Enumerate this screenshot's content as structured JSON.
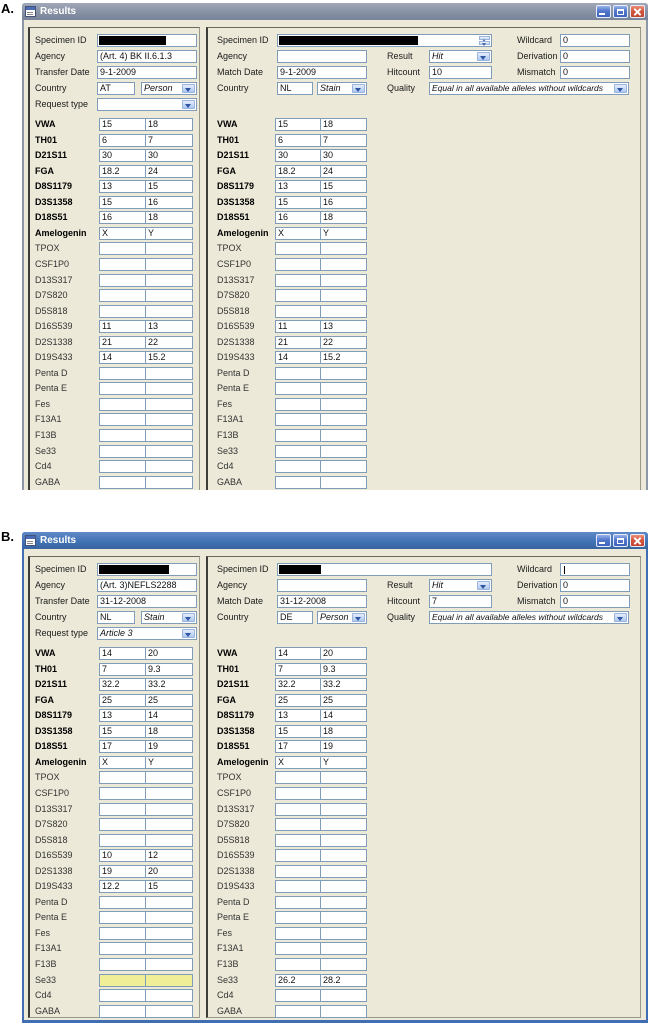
{
  "figure_labels": [
    "A.",
    "B."
  ],
  "colors": {
    "window_background": "#ece9d8",
    "titlebar_inactive": "#8d97a8",
    "titlebar_active": "#3f6fb2",
    "close_button_red": "#d55740",
    "field_border_blue": "#7f9db9",
    "highlight_yellow": "#f0ee96"
  },
  "windows": [
    {
      "title": "Results",
      "active": false,
      "left_panel": {
        "specimen_id_label": "Specimen ID",
        "specimen_id_redacted": true,
        "agency_label": "Agency",
        "agency": "(Art. 4) BK II.6.1.3",
        "date_label": "Transfer Date",
        "date": "9-1-2009",
        "country_label": "Country",
        "country_code": "AT",
        "sample_type": "Person",
        "request_type_label": "Request type",
        "request_type": ""
      },
      "right_panel": {
        "specimen_id_label": "Specimen ID",
        "specimen_id_redacted": true,
        "agency_label": "Agency",
        "agency": "",
        "date_label": "Match Date",
        "date": "9-1-2009",
        "country_label": "Country",
        "country_code": "NL",
        "sample_type": "Stain",
        "result_label": "Result",
        "result": "Hit",
        "hitcount_label": "Hitcount",
        "hitcount": "10",
        "quality_label": "Quality",
        "quality": "Equal in all available alleles without wildcards",
        "wildcard_label": "Wildcard",
        "wildcard": "0",
        "wildcard_cursor": false,
        "derivation_label": "Derivation",
        "derivation": "0",
        "mismatch_label": "Mismatch",
        "mismatch": "0"
      },
      "markers": [
        {
          "name": "VWA",
          "bold": true,
          "left": [
            "15",
            "18"
          ],
          "right": [
            "15",
            "18"
          ]
        },
        {
          "name": "TH01",
          "bold": true,
          "left": [
            "6",
            "7"
          ],
          "right": [
            "6",
            "7"
          ]
        },
        {
          "name": "D21S11",
          "bold": true,
          "left": [
            "30",
            "30"
          ],
          "right": [
            "30",
            "30"
          ]
        },
        {
          "name": "FGA",
          "bold": true,
          "left": [
            "18.2",
            "24"
          ],
          "right": [
            "18.2",
            "24"
          ]
        },
        {
          "name": "D8S1179",
          "bold": true,
          "left": [
            "13",
            "15"
          ],
          "right": [
            "13",
            "15"
          ]
        },
        {
          "name": "D3S1358",
          "bold": true,
          "left": [
            "15",
            "16"
          ],
          "right": [
            "15",
            "16"
          ]
        },
        {
          "name": "D18S51",
          "bold": true,
          "left": [
            "16",
            "18"
          ],
          "right": [
            "16",
            "18"
          ]
        },
        {
          "name": "Amelogenin",
          "bold": true,
          "left": [
            "X",
            "Y"
          ],
          "right": [
            "X",
            "Y"
          ]
        },
        {
          "name": "TPOX",
          "bold": false,
          "left": [
            "",
            ""
          ],
          "right": [
            "",
            ""
          ]
        },
        {
          "name": "CSF1P0",
          "bold": false,
          "left": [
            "",
            ""
          ],
          "right": [
            "",
            ""
          ]
        },
        {
          "name": "D13S317",
          "bold": false,
          "left": [
            "",
            ""
          ],
          "right": [
            "",
            ""
          ]
        },
        {
          "name": "D7S820",
          "bold": false,
          "left": [
            "",
            ""
          ],
          "right": [
            "",
            ""
          ]
        },
        {
          "name": "D5S818",
          "bold": false,
          "left": [
            "",
            ""
          ],
          "right": [
            "",
            ""
          ]
        },
        {
          "name": "D16S539",
          "bold": false,
          "left": [
            "11",
            "13"
          ],
          "right": [
            "11",
            "13"
          ]
        },
        {
          "name": "D2S1338",
          "bold": false,
          "left": [
            "21",
            "22"
          ],
          "right": [
            "21",
            "22"
          ]
        },
        {
          "name": "D19S433",
          "bold": false,
          "left": [
            "14",
            "15.2"
          ],
          "right": [
            "14",
            "15.2"
          ]
        },
        {
          "name": "Penta D",
          "bold": false,
          "left": [
            "",
            ""
          ],
          "right": [
            "",
            ""
          ]
        },
        {
          "name": "Penta E",
          "bold": false,
          "left": [
            "",
            ""
          ],
          "right": [
            "",
            ""
          ]
        },
        {
          "name": "Fes",
          "bold": false,
          "left": [
            "",
            ""
          ],
          "right": [
            "",
            ""
          ]
        },
        {
          "name": "F13A1",
          "bold": false,
          "left": [
            "",
            ""
          ],
          "right": [
            "",
            ""
          ]
        },
        {
          "name": "F13B",
          "bold": false,
          "left": [
            "",
            ""
          ],
          "right": [
            "",
            ""
          ]
        },
        {
          "name": "Se33",
          "bold": false,
          "left": [
            "",
            ""
          ],
          "right": [
            "",
            ""
          ]
        },
        {
          "name": "Cd4",
          "bold": false,
          "left": [
            "",
            ""
          ],
          "right": [
            "",
            ""
          ]
        },
        {
          "name": "GABA",
          "bold": false,
          "left": [
            "",
            ""
          ],
          "right": [
            "",
            ""
          ]
        }
      ]
    },
    {
      "title": "Results",
      "active": true,
      "left_panel": {
        "specimen_id_label": "Specimen ID",
        "specimen_id_redacted": true,
        "agency_label": "Agency",
        "agency": "(Art. 3)NEFLS2288",
        "date_label": "Transfer Date",
        "date": "31-12-2008",
        "country_label": "Country",
        "country_code": "NL",
        "sample_type": "Stain",
        "request_type_label": "Request type",
        "request_type": "Article 3"
      },
      "right_panel": {
        "specimen_id_label": "Specimen ID",
        "specimen_id_redacted": true,
        "agency_label": "Agency",
        "agency": "",
        "date_label": "Match Date",
        "date": "31-12-2008",
        "country_label": "Country",
        "country_code": "DE",
        "sample_type": "Person",
        "result_label": "Result",
        "result": "Hit",
        "hitcount_label": "Hitcount",
        "hitcount": "7",
        "quality_label": "Quality",
        "quality": "Equal in all available alleles without wildcards",
        "wildcard_label": "Wildcard",
        "wildcard": "",
        "wildcard_cursor": true,
        "derivation_label": "Derivation",
        "derivation": "0",
        "mismatch_label": "Mismatch",
        "mismatch": "0"
      },
      "markers": [
        {
          "name": "VWA",
          "bold": true,
          "left": [
            "14",
            "20"
          ],
          "right": [
            "14",
            "20"
          ]
        },
        {
          "name": "TH01",
          "bold": true,
          "left": [
            "7",
            "9.3"
          ],
          "right": [
            "7",
            "9.3"
          ]
        },
        {
          "name": "D21S11",
          "bold": true,
          "left": [
            "32.2",
            "33.2"
          ],
          "right": [
            "32.2",
            "33.2"
          ]
        },
        {
          "name": "FGA",
          "bold": true,
          "left": [
            "25",
            "25"
          ],
          "right": [
            "25",
            "25"
          ]
        },
        {
          "name": "D8S1179",
          "bold": true,
          "left": [
            "13",
            "14"
          ],
          "right": [
            "13",
            "14"
          ]
        },
        {
          "name": "D3S1358",
          "bold": true,
          "left": [
            "15",
            "18"
          ],
          "right": [
            "15",
            "18"
          ]
        },
        {
          "name": "D18S51",
          "bold": true,
          "left": [
            "17",
            "19"
          ],
          "right": [
            "17",
            "19"
          ]
        },
        {
          "name": "Amelogenin",
          "bold": true,
          "left": [
            "X",
            "Y"
          ],
          "right": [
            "X",
            "Y"
          ]
        },
        {
          "name": "TPOX",
          "bold": false,
          "left": [
            "",
            ""
          ],
          "right": [
            "",
            ""
          ]
        },
        {
          "name": "CSF1P0",
          "bold": false,
          "left": [
            "",
            ""
          ],
          "right": [
            "",
            ""
          ]
        },
        {
          "name": "D13S317",
          "bold": false,
          "left": [
            "",
            ""
          ],
          "right": [
            "",
            ""
          ]
        },
        {
          "name": "D7S820",
          "bold": false,
          "left": [
            "",
            ""
          ],
          "right": [
            "",
            ""
          ]
        },
        {
          "name": "D5S818",
          "bold": false,
          "left": [
            "",
            ""
          ],
          "right": [
            "",
            ""
          ]
        },
        {
          "name": "D16S539",
          "bold": false,
          "left": [
            "10",
            "12"
          ],
          "right": [
            "",
            ""
          ]
        },
        {
          "name": "D2S1338",
          "bold": false,
          "left": [
            "19",
            "20"
          ],
          "right": [
            "",
            ""
          ]
        },
        {
          "name": "D19S433",
          "bold": false,
          "left": [
            "12.2",
            "15"
          ],
          "right": [
            "",
            ""
          ]
        },
        {
          "name": "Penta D",
          "bold": false,
          "left": [
            "",
            ""
          ],
          "right": [
            "",
            ""
          ]
        },
        {
          "name": "Penta E",
          "bold": false,
          "left": [
            "",
            ""
          ],
          "right": [
            "",
            ""
          ]
        },
        {
          "name": "Fes",
          "bold": false,
          "left": [
            "",
            ""
          ],
          "right": [
            "",
            ""
          ]
        },
        {
          "name": "F13A1",
          "bold": false,
          "left": [
            "",
            ""
          ],
          "right": [
            "",
            ""
          ]
        },
        {
          "name": "F13B",
          "bold": false,
          "left": [
            "",
            ""
          ],
          "right": [
            "",
            ""
          ]
        },
        {
          "name": "Se33",
          "bold": false,
          "left": [
            "",
            ""
          ],
          "left_highlight": true,
          "right": [
            "26.2",
            "28.2"
          ]
        },
        {
          "name": "Cd4",
          "bold": false,
          "left": [
            "",
            ""
          ],
          "right": [
            "",
            ""
          ]
        },
        {
          "name": "GABA",
          "bold": false,
          "left": [
            "",
            ""
          ],
          "right": [
            "",
            ""
          ]
        }
      ]
    }
  ]
}
